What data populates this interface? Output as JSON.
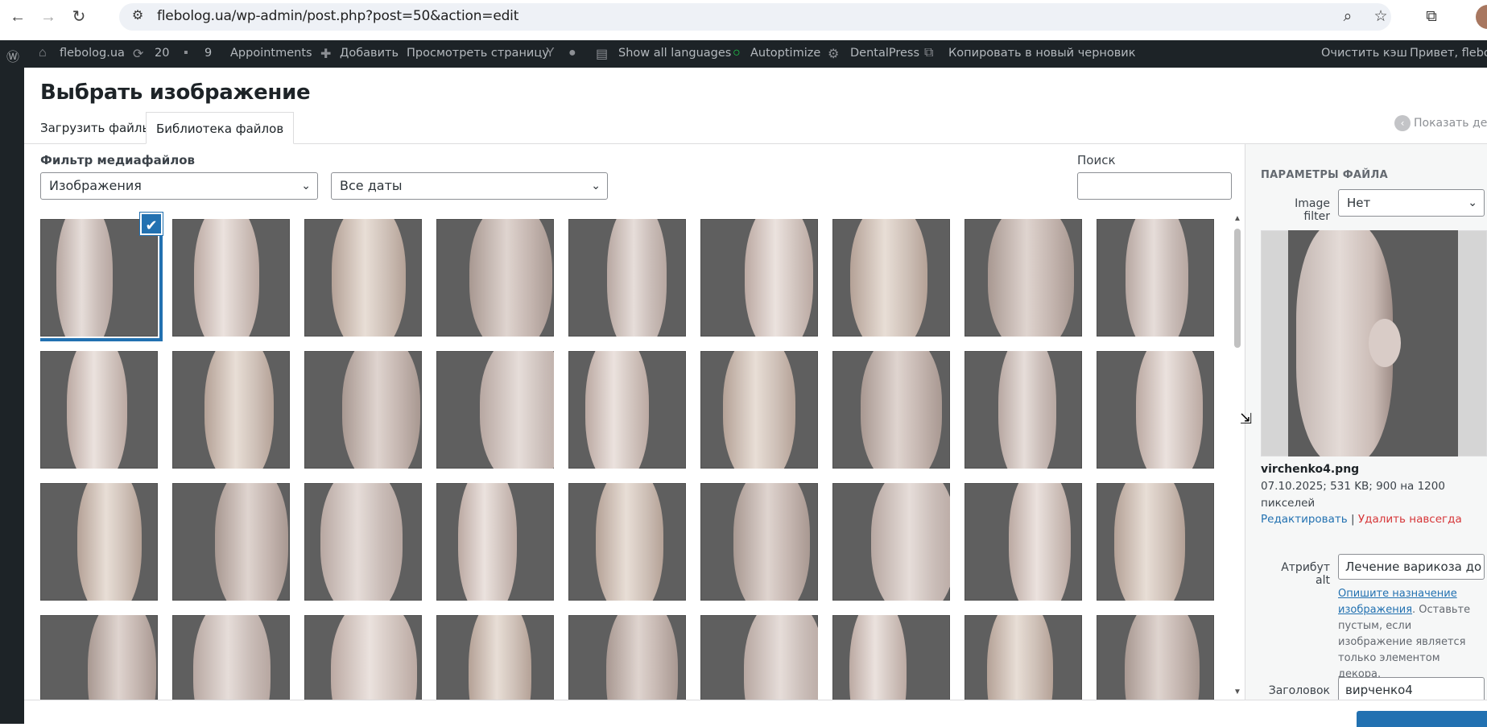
{
  "browser": {
    "url": "flebolog.ua/wp-admin/post.php?post=50&action=edit",
    "icons": [
      "back-icon",
      "forward-icon",
      "reload-icon",
      "site-settings-icon",
      "zoom-icon",
      "bookmark-star-icon",
      "extensions-icon",
      "profile-avatar"
    ]
  },
  "adminbar": {
    "site": "flebolog.ua",
    "updates": "20",
    "comments": "9",
    "appointments": "Appointments",
    "add_new": "Добавить",
    "view_page": "Просмотреть страницу",
    "languages": "Show all languages",
    "autoptimize": "Autoptimize",
    "dentalpress": "DentalPress",
    "copy_draft": "Копировать в новый черновик",
    "clear_cache": "Очистить кэш",
    "greeting": "Привет, flebolog"
  },
  "modal": {
    "title": "Выбрать изображение",
    "tabs": [
      "Загрузить файлы",
      "Библиотека файлов"
    ],
    "active_tab": "Библиотека файлов",
    "show_details": "Показать дета"
  },
  "filters": {
    "label": "Фильтр медиафайлов",
    "type_value": "Изображения",
    "date_value": "Все даты",
    "search_label": "Поиск",
    "search_value": ""
  },
  "grid": {
    "rows": 4,
    "cols": 9,
    "selected_index": 0
  },
  "details": {
    "heading": "ПАРАМЕТРЫ ФАЙЛА",
    "image_filter_label": "Image filter",
    "image_filter_value": "Нет",
    "filename": "virchenko4.png",
    "meta_line1": "07.10.2025; 531 KB; 900 на 1200",
    "meta_line2": "пикселей",
    "edit_link": "Редактировать",
    "separator": "|",
    "delete_link": "Удалить навсегда",
    "alt_label": "Атрибут alt",
    "alt_value": "Лечение варикоза до и п",
    "help_link": "Опишите назначение изображения",
    "help_text": ". Оставьте пустым, если изображение является только элементом декора.",
    "title_label": "Заголовок",
    "title_value": "вирченко4"
  },
  "colors": {
    "accent": "#2271b1",
    "adminbar_bg": "#1d2327",
    "delete": "#d63638"
  }
}
